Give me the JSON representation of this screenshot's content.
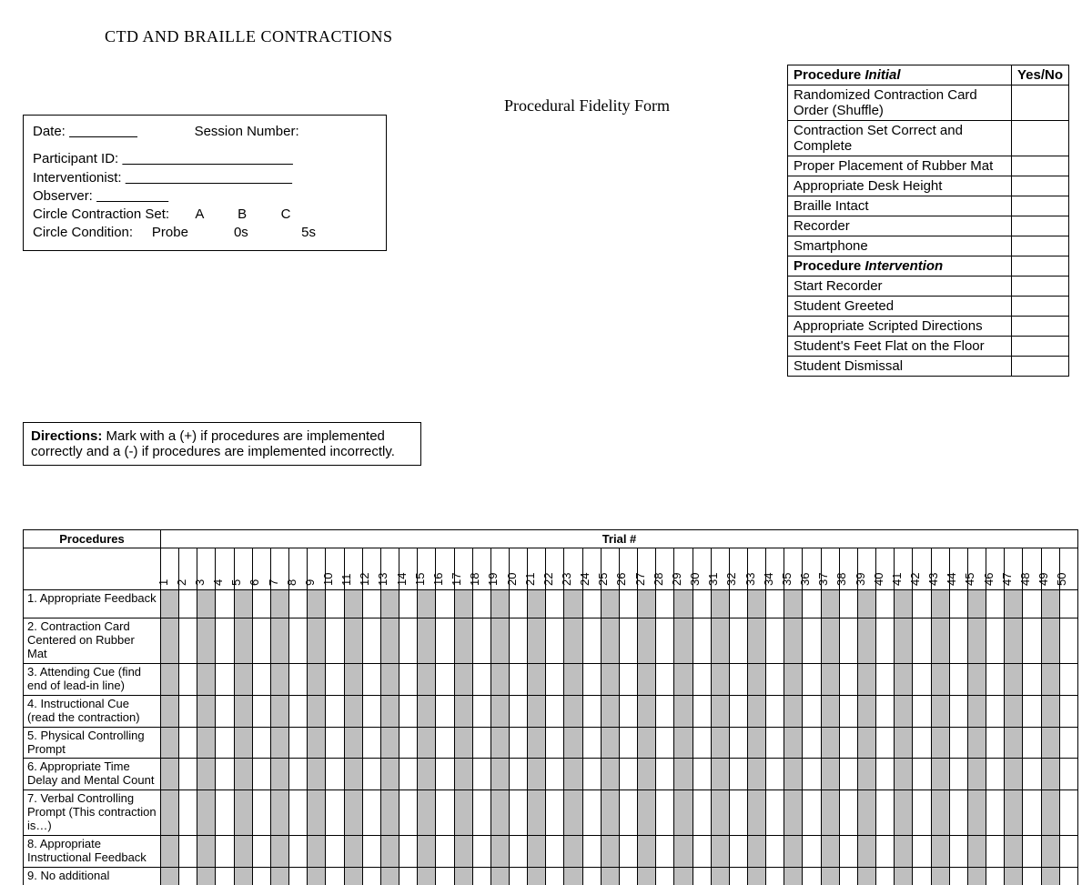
{
  "title": "CTD AND BRAILLE CONTRACTIONS",
  "subtitle": "Procedural Fidelity Form",
  "info": {
    "date_label": "Date:",
    "session_label": "Session Number:",
    "participant_label": "Participant ID:",
    "interventionist_label": "Interventionist:",
    "observer_label": "Observer:",
    "circle_set_label": "Circle Contraction Set:",
    "set_options": [
      "A",
      "B",
      "C"
    ],
    "circle_cond_label": "Circle Condition:",
    "cond_options": [
      "Probe",
      "0s",
      "5s"
    ]
  },
  "procedure_table": {
    "header1_a": "Procedure ",
    "header1_b": "Initial",
    "yn": "Yes/No",
    "rows_initial": [
      "Randomized Contraction Card Order (Shuffle)",
      "Contraction Set Correct and Complete",
      "Proper Placement of Rubber Mat",
      "Appropriate Desk Height",
      "Braille Intact",
      "Recorder",
      "Smartphone"
    ],
    "header2_a": "Procedure ",
    "header2_b": "Intervention",
    "rows_intervention": [
      "Start Recorder",
      "Student Greeted",
      "Appropriate Scripted Directions",
      "Student's Feet Flat on the Floor",
      "Student Dismissal"
    ]
  },
  "directions_label": "Directions:",
  "directions_text": " Mark with a (+) if procedures are implemented correctly and a (-) if procedures are implemented incorrectly.",
  "trial": {
    "proc_header": "Procedures",
    "trial_header": "Trial #",
    "numbers": [
      "1",
      "2",
      "3",
      "4",
      "5",
      "6",
      "7",
      "8",
      "9",
      "10",
      "11",
      "12",
      "13",
      "14",
      "15",
      "16",
      "17",
      "18",
      "19",
      "20",
      "21",
      "22",
      "23",
      "24",
      "25",
      "26",
      "27",
      "28",
      "29",
      "30",
      "31",
      "32",
      "33",
      "34",
      "35",
      "36",
      "37",
      "38",
      "39",
      "40",
      "41",
      "42",
      "43",
      "44",
      "45",
      "46",
      "47",
      "48",
      "49",
      "50"
    ],
    "rows": [
      "1. Appropriate Feedback",
      "2. Contraction Card Centered on Rubber Mat",
      "3. Attending Cue (find end of lead-in line)",
      "4. Instructional Cue (read the contraction)",
      "5. Physical Controlling Prompt",
      "6. Appropriate Time Delay and Mental Count",
      "7. Verbal Controlling Prompt (This contraction is…)",
      "8. Appropriate Instructional Feedback"
    ],
    "cutoff_row": "9. No additional"
  }
}
